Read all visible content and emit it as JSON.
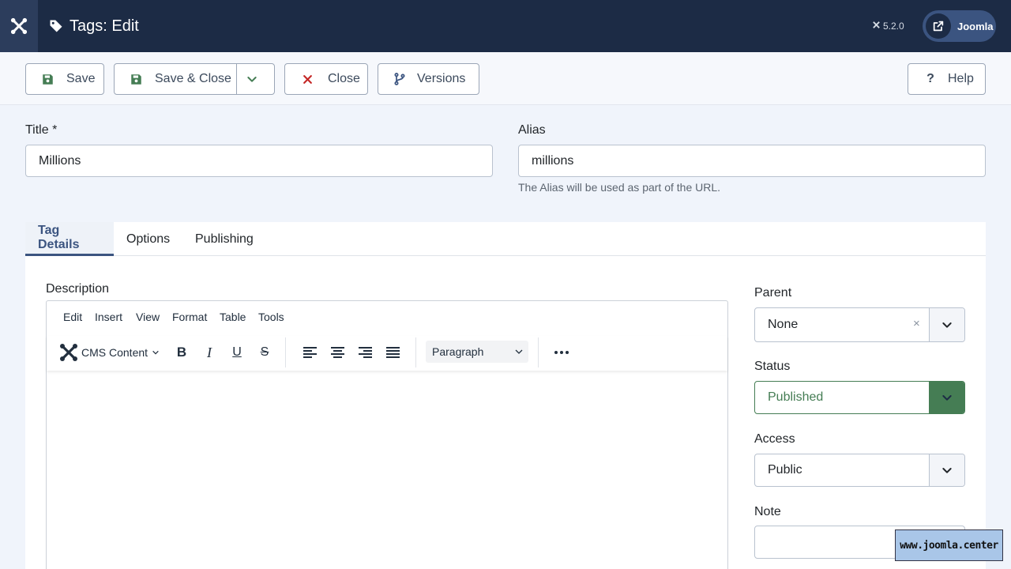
{
  "header": {
    "title": "Tags: Edit",
    "version": "5.2.0",
    "site_button_label": "Joomla"
  },
  "toolbar": {
    "save": "Save",
    "save_close": "Save & Close",
    "close": "Close",
    "versions": "Versions",
    "help": "Help"
  },
  "form": {
    "title_label": "Title *",
    "title_value": "Millions",
    "alias_label": "Alias",
    "alias_value": "millions",
    "alias_hint": "The Alias will be used as part of the URL."
  },
  "tabs": [
    {
      "label": "Tag Details",
      "active": true
    },
    {
      "label": "Options",
      "active": false
    },
    {
      "label": "Publishing",
      "active": false
    }
  ],
  "editor": {
    "label": "Description",
    "menu": [
      "Edit",
      "Insert",
      "View",
      "Format",
      "Table",
      "Tools"
    ],
    "cms_content": "CMS Content",
    "block_format": "Paragraph"
  },
  "sidebar": {
    "parent_label": "Parent",
    "parent_value": "None",
    "status_label": "Status",
    "status_value": "Published",
    "access_label": "Access",
    "access_value": "Public",
    "note_label": "Note",
    "note_value": ""
  },
  "colors": {
    "header_bg": "#1c2b45",
    "accent": "#3b5480",
    "status_green": "#457d54",
    "close_red": "#c52827"
  },
  "watermark": "www.joomla.center"
}
